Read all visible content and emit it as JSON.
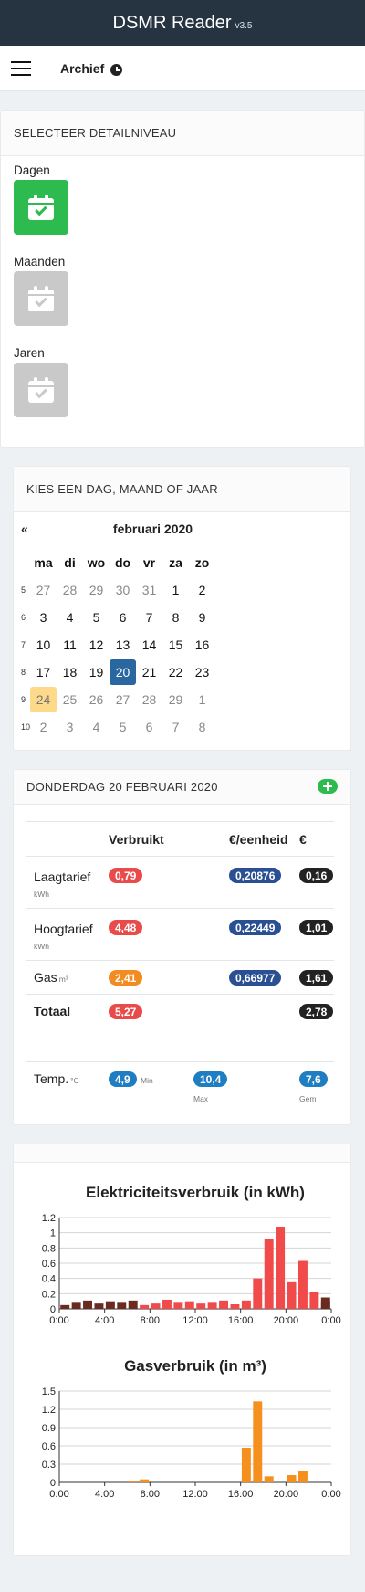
{
  "app": {
    "title": "DSMR Reader",
    "version": "v3.5"
  },
  "nav": {
    "title": "Archief"
  },
  "detail": {
    "header": "SELECTEER DETAILNIVEAU",
    "levels": [
      {
        "label": "Dagen",
        "active": true
      },
      {
        "label": "Maanden",
        "active": false
      },
      {
        "label": "Jaren",
        "active": false
      }
    ]
  },
  "calendar": {
    "header": "KIES EEN DAG, MAAND OF JAAR",
    "prev": "«",
    "month": "februari 2020",
    "weekdays": [
      "ma",
      "di",
      "wo",
      "do",
      "vr",
      "za",
      "zo"
    ],
    "weeks": [
      {
        "num": "5",
        "days": [
          "27",
          "28",
          "29",
          "30",
          "31",
          "1",
          "2"
        ]
      },
      {
        "num": "6",
        "days": [
          "3",
          "4",
          "5",
          "6",
          "7",
          "8",
          "9"
        ]
      },
      {
        "num": "7",
        "days": [
          "10",
          "11",
          "12",
          "13",
          "14",
          "15",
          "16"
        ]
      },
      {
        "num": "8",
        "days": [
          "17",
          "18",
          "19",
          "20",
          "21",
          "22",
          "23"
        ]
      },
      {
        "num": "9",
        "days": [
          "24",
          "25",
          "26",
          "27",
          "28",
          "29",
          "1"
        ]
      },
      {
        "num": "10",
        "days": [
          "2",
          "3",
          "4",
          "5",
          "6",
          "7",
          "8"
        ]
      }
    ]
  },
  "summary": {
    "header": "DONDERDAG 20 FEBRUARI 2020",
    "col_used": "Verbruikt",
    "col_unit": "€/eenheid",
    "col_cost": "€",
    "rows": [
      {
        "label": "Laagtarief",
        "unit": "kWh",
        "used": "0,79",
        "price": "0,20876",
        "cost": "0,16"
      },
      {
        "label": "Hoogtarief",
        "unit": "kWh",
        "used": "4,48",
        "price": "0,22449",
        "cost": "1,01"
      },
      {
        "label": "Gas",
        "unit": "m³",
        "used": "2,41",
        "price": "0,66977",
        "cost": "1,61"
      }
    ],
    "total": {
      "label": "Totaal",
      "used": "5,27",
      "cost": "2,78"
    },
    "temp": {
      "label": "Temp.",
      "unit": "°C",
      "min": "4,9",
      "min_label": "Min",
      "max": "10,4",
      "max_label": "Max",
      "avg": "7,6",
      "avg_label": "Gem"
    }
  },
  "colors": {
    "electricity_high": "#f04a4a",
    "electricity_low": "#6b2a1f",
    "gas": "#f58f1e"
  },
  "chart_data": [
    {
      "type": "bar",
      "title": "Elektriciteitsverbruik (in kWh)",
      "x": [
        "0:00",
        "1:00",
        "2:00",
        "3:00",
        "4:00",
        "5:00",
        "6:00",
        "7:00",
        "8:00",
        "9:00",
        "10:00",
        "11:00",
        "12:00",
        "13:00",
        "14:00",
        "15:00",
        "16:00",
        "17:00",
        "18:00",
        "19:00",
        "20:00",
        "21:00",
        "22:00",
        "23:00"
      ],
      "series": [
        {
          "values": [
            0.05,
            0.08,
            0.11,
            0.07,
            0.1,
            0.08,
            0.11,
            0.05,
            0.07,
            0.12,
            0.08,
            0.1,
            0.07,
            0.08,
            0.11,
            0.06,
            0.11,
            0.4,
            0.92,
            1.08,
            0.35,
            0.63,
            0.22,
            0.15
          ],
          "tariff": [
            "low",
            "low",
            "low",
            "low",
            "low",
            "low",
            "low",
            "high",
            "high",
            "high",
            "high",
            "high",
            "high",
            "high",
            "high",
            "high",
            "high",
            "high",
            "high",
            "high",
            "high",
            "high",
            "high",
            "low"
          ]
        },
        {
          "values": [
            0,
            0,
            0,
            0,
            0,
            0,
            0,
            0,
            0,
            0,
            0,
            0,
            0,
            0,
            0,
            0,
            0,
            0,
            0,
            0,
            0,
            0,
            0,
            0.1
          ]
        }
      ],
      "x_ticks": [
        "0:00",
        "4:00",
        "8:00",
        "12:00",
        "16:00",
        "20:00",
        "0:00"
      ],
      "y_ticks": [
        "0",
        "0.2",
        "0.4",
        "0.6",
        "0.8",
        "1",
        "1.2"
      ],
      "ylim": [
        0,
        1.2
      ],
      "grid": true
    },
    {
      "type": "bar",
      "title": "Gasverbruik (in m³)",
      "x": [
        "0:00",
        "1:00",
        "2:00",
        "3:00",
        "4:00",
        "5:00",
        "6:00",
        "7:00",
        "8:00",
        "9:00",
        "10:00",
        "11:00",
        "12:00",
        "13:00",
        "14:00",
        "15:00",
        "16:00",
        "17:00",
        "18:00",
        "19:00",
        "20:00",
        "21:00",
        "22:00",
        "23:00"
      ],
      "series": [
        {
          "values": [
            0,
            0,
            0,
            0,
            0,
            0,
            0.02,
            0.05,
            0,
            0,
            0,
            0,
            0,
            0,
            0,
            0,
            0.57,
            1.33,
            0.1,
            0,
            0.12,
            0.18,
            0,
            0
          ]
        }
      ],
      "x_ticks": [
        "0:00",
        "4:00",
        "8:00",
        "12:00",
        "16:00",
        "20:00",
        "0:00"
      ],
      "y_ticks": [
        "0",
        "0.3",
        "0.6",
        "0.9",
        "1.2",
        "1.5"
      ],
      "ylim": [
        0,
        1.5
      ],
      "grid": true
    }
  ]
}
